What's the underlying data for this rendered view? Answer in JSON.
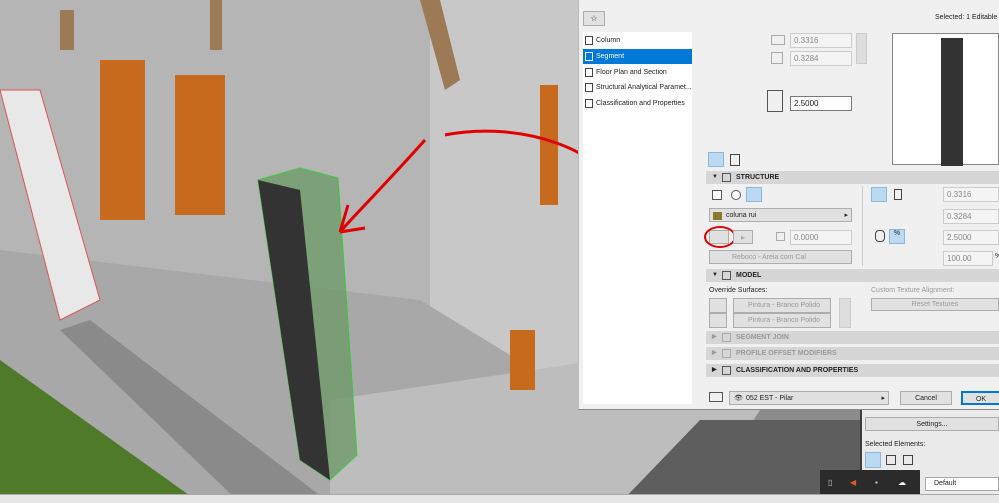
{
  "dialog": {
    "selected_label": "Selected: 1 Editable",
    "nav": [
      {
        "label": "Column"
      },
      {
        "label": "Segment",
        "active": true
      },
      {
        "label": "Floor Plan and Section"
      },
      {
        "label": "Structural Analytical Paramet..."
      },
      {
        "label": "Classification and Properties"
      }
    ],
    "top_width": "0.3316",
    "top_depth": "0.3284",
    "top_height": "2.5000",
    "sections": {
      "structure": "STRUCTURE",
      "model": "MODEL",
      "segment_join": "SEGMENT JOIN",
      "profile_offset": "PROFILE OFFSET MODIFIERS",
      "classification": "CLASSIFICATION AND PROPERTIES"
    },
    "structure": {
      "material": "coluna rui",
      "veneer_thickness": "0.0000",
      "veneer_material": "Reboco - Areia com Cal",
      "width": "0.3316",
      "depth": "0.3284",
      "height": "2.5000",
      "percent": "100.00",
      "percent_unit": "%"
    },
    "model": {
      "override_label": "Override Surfaces:",
      "surface1": "Pintura - Branco Polido",
      "surface2": "Pintura - Branco Polido",
      "texture_label": "Custom Texture Alignment:",
      "reset_textures": "Reset Textures"
    },
    "layer": "052 EST - Pilar",
    "cancel": "Cancel",
    "ok": "OK"
  },
  "side_panel": {
    "settings": "Settings...",
    "selected_elements": "Selected Elements:",
    "default": "Default"
  },
  "colors": {
    "accent": "#0078d7",
    "annotation": "#e00000",
    "selection": "#22cc22"
  }
}
